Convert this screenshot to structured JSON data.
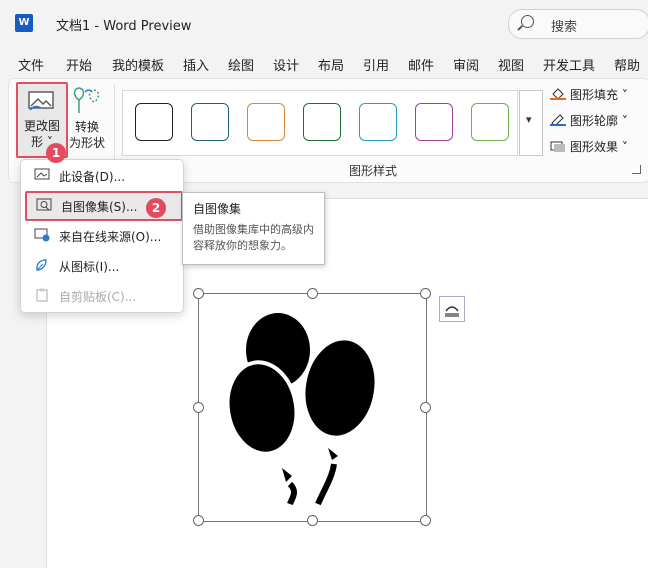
{
  "window": {
    "app_icon": "W",
    "title": "文档1  -  Word Preview"
  },
  "search": {
    "placeholder": "搜索",
    "icon": "search-icon"
  },
  "menu": [
    "文件",
    "开始",
    "我的模板",
    "插入",
    "绘图",
    "设计",
    "布局",
    "引用",
    "邮件",
    "审阅",
    "视图",
    "开发工具",
    "帮助"
  ],
  "ribbon": {
    "change_shape_label_1": "更改图",
    "change_shape_label_2": "形 ˅",
    "convert_label_1": "转换",
    "convert_label_2": "为形状",
    "styles_group_label": "图形样式",
    "swatch_colors": [
      "#222222",
      "#1f5f7f",
      "#d9863a",
      "#1f6e3a",
      "#2a9cc2",
      "#a23e9a",
      "#6ab04c"
    ],
    "gallery_scroll_glyph": "▾",
    "fill": "图形填充 ˅",
    "outline": "图形轮廓 ˅",
    "effects": "图形效果 ˅"
  },
  "dropdown": {
    "items": [
      {
        "label": "此设备(D)...",
        "icon": "device-image-icon",
        "disabled": false
      },
      {
        "label": "自图像集(S)...",
        "icon": "image-set-icon",
        "disabled": false
      },
      {
        "label": "来自在线来源(O)...",
        "icon": "online-image-icon",
        "disabled": false
      },
      {
        "label": "从图标(I)...",
        "icon": "icon-library-icon",
        "disabled": false
      },
      {
        "label": "自剪贴板(C)...",
        "icon": "clipboard-image-icon",
        "disabled": true
      }
    ]
  },
  "tooltip": {
    "title": "自图像集",
    "body": "借助图像集库中的高级内容释放你的想象力。"
  },
  "badges": [
    "1",
    "2"
  ],
  "colors": {
    "accent_red": "#e05060",
    "badge": "#e34b5f"
  }
}
